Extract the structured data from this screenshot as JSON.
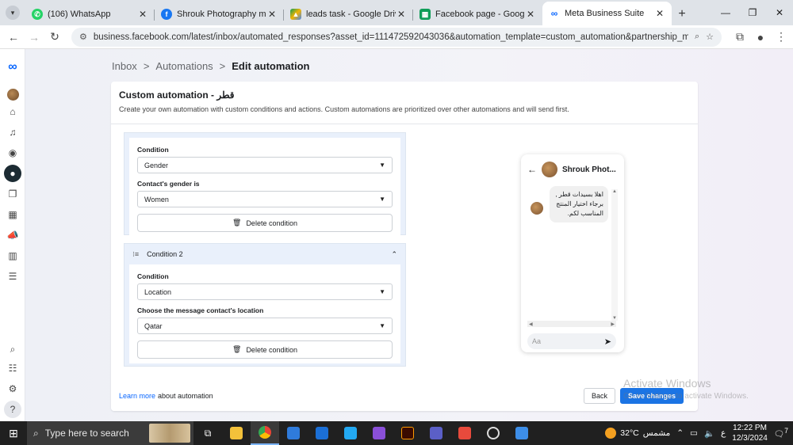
{
  "browser": {
    "tabs": [
      {
        "title": "(106) WhatsApp",
        "icon": "whatsapp-icon",
        "color": "#25d366"
      },
      {
        "title": "Shrouk Photography messag",
        "icon": "facebook-icon",
        "color": "#1877f2"
      },
      {
        "title": "leads task - Google Drive",
        "icon": "google-drive-icon",
        "color": "#f4b400"
      },
      {
        "title": "Facebook page - Google Sh",
        "icon": "google-sheets-icon",
        "color": "#0f9d58"
      },
      {
        "title": "Meta Business Suite",
        "icon": "meta-icon",
        "color": "#0866ff",
        "active": true
      }
    ],
    "url": "business.facebook.com/latest/inbox/automated_responses?asset_id=111472592043036&automation_template=custom_automation&partnership_messages=fa..."
  },
  "breadcrumb": {
    "items": [
      "Inbox",
      "Automations"
    ],
    "separator": ">",
    "current": "Edit automation"
  },
  "card": {
    "title": "Custom automation - قطر",
    "description": "Create your own automation with custom conditions and actions. Custom automations are prioritized over other automations and will send first."
  },
  "condition1": {
    "condition_label": "Condition",
    "condition_value": "Gender",
    "sub_label": "Contact's gender is",
    "sub_value": "Women",
    "delete_label": "Delete condition"
  },
  "condition2": {
    "header": "Condition 2",
    "condition_label": "Condition",
    "condition_value": "Location",
    "sub_label": "Choose the message contact's location",
    "sub_value": "Qatar",
    "delete_label": "Delete condition"
  },
  "footer": {
    "learn_more": "Learn more",
    "learn_more_suffix": "about automation",
    "back": "Back",
    "save": "Save changes"
  },
  "preview": {
    "page_name": "Shrouk Phot...",
    "message": "اهلا بسيدات قطر , برجاء اختيار المنتج المناسب لكم.",
    "composer_placeholder": "Aa"
  },
  "watermark": {
    "title": "Activate Windows",
    "subtitle": "Go to Settings to activate Windows."
  },
  "taskbar": {
    "search_placeholder": "Type here to search",
    "weather": "32°C",
    "weather_desc": "مشمس",
    "lang": "ع",
    "time": "12:22 PM",
    "date": "12/3/2024",
    "notifications": "7"
  }
}
